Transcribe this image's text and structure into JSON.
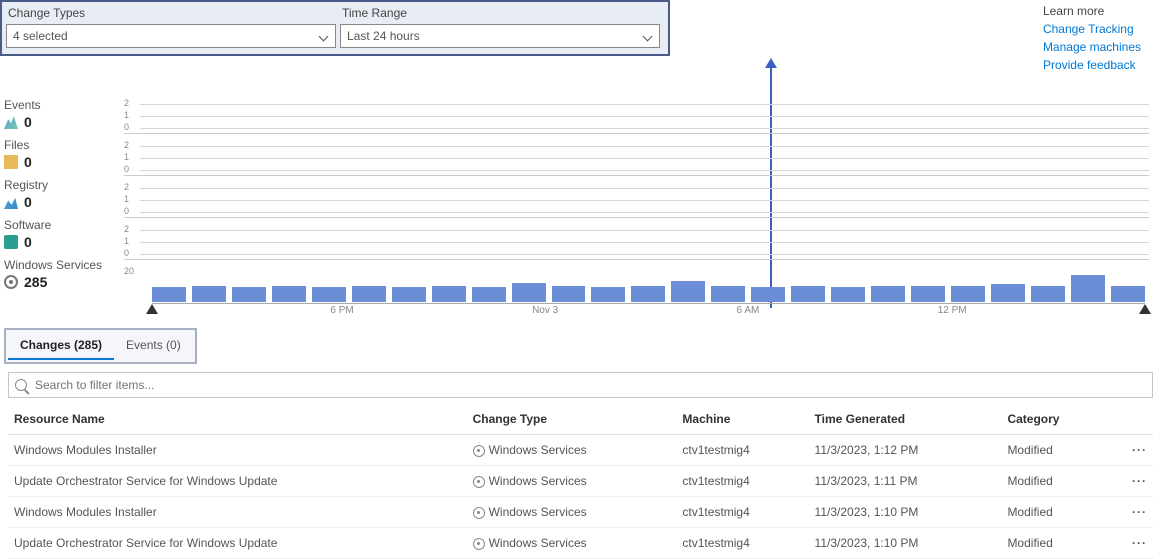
{
  "filters": {
    "change_types": {
      "label": "Change Types",
      "value": "4 selected"
    },
    "time_range": {
      "label": "Time Range",
      "value": "Last 24 hours"
    }
  },
  "learn_more": {
    "header": "Learn more",
    "links": [
      "Change Tracking",
      "Manage machines",
      "Provide feedback"
    ]
  },
  "stats": {
    "events": {
      "label": "Events",
      "value": "0"
    },
    "files": {
      "label": "Files",
      "value": "0"
    },
    "registry": {
      "label": "Registry",
      "value": "0"
    },
    "software": {
      "label": "Software",
      "value": "0"
    },
    "services": {
      "label": "Windows Services",
      "value": "285"
    }
  },
  "chart_data": {
    "sparklines": [
      {
        "name": "events",
        "ticks": [
          "2",
          "1",
          "0"
        ]
      },
      {
        "name": "files",
        "ticks": [
          "2",
          "1",
          "0"
        ]
      },
      {
        "name": "registry",
        "ticks": [
          "2",
          "1",
          "0"
        ]
      },
      {
        "name": "software",
        "ticks": [
          "2",
          "1",
          "0"
        ]
      }
    ],
    "main": {
      "type": "bar",
      "ylabel_top": "20",
      "x_ticks": [
        "6 PM",
        "Nov 3",
        "6 AM",
        "12 PM"
      ],
      "values": [
        10,
        11,
        10,
        11,
        10,
        11,
        10,
        11,
        10,
        13,
        11,
        10,
        11,
        14,
        11,
        10,
        11,
        10,
        11,
        11,
        11,
        12,
        11,
        18,
        11
      ],
      "ylim": [
        0,
        20
      ]
    }
  },
  "tabs": {
    "changes": "Changes (285)",
    "events": "Events (0)"
  },
  "search": {
    "placeholder": "Search to filter items..."
  },
  "table": {
    "headers": {
      "resource": "Resource Name",
      "type": "Change Type",
      "machine": "Machine",
      "time": "Time Generated",
      "category": "Category"
    },
    "rows": [
      {
        "resource": "Windows Modules Installer",
        "type": "Windows Services",
        "machine": "ctv1testmig4",
        "time": "11/3/2023, 1:12 PM",
        "category": "Modified"
      },
      {
        "resource": "Update Orchestrator Service for Windows Update",
        "type": "Windows Services",
        "machine": "ctv1testmig4",
        "time": "11/3/2023, 1:11 PM",
        "category": "Modified"
      },
      {
        "resource": "Windows Modules Installer",
        "type": "Windows Services",
        "machine": "ctv1testmig4",
        "time": "11/3/2023, 1:10 PM",
        "category": "Modified"
      },
      {
        "resource": "Update Orchestrator Service for Windows Update",
        "type": "Windows Services",
        "machine": "ctv1testmig4",
        "time": "11/3/2023, 1:10 PM",
        "category": "Modified"
      }
    ]
  },
  "colors": {
    "bar": "#6b8ed6",
    "link": "#0078d4",
    "indicator": "#3b5fc0"
  }
}
